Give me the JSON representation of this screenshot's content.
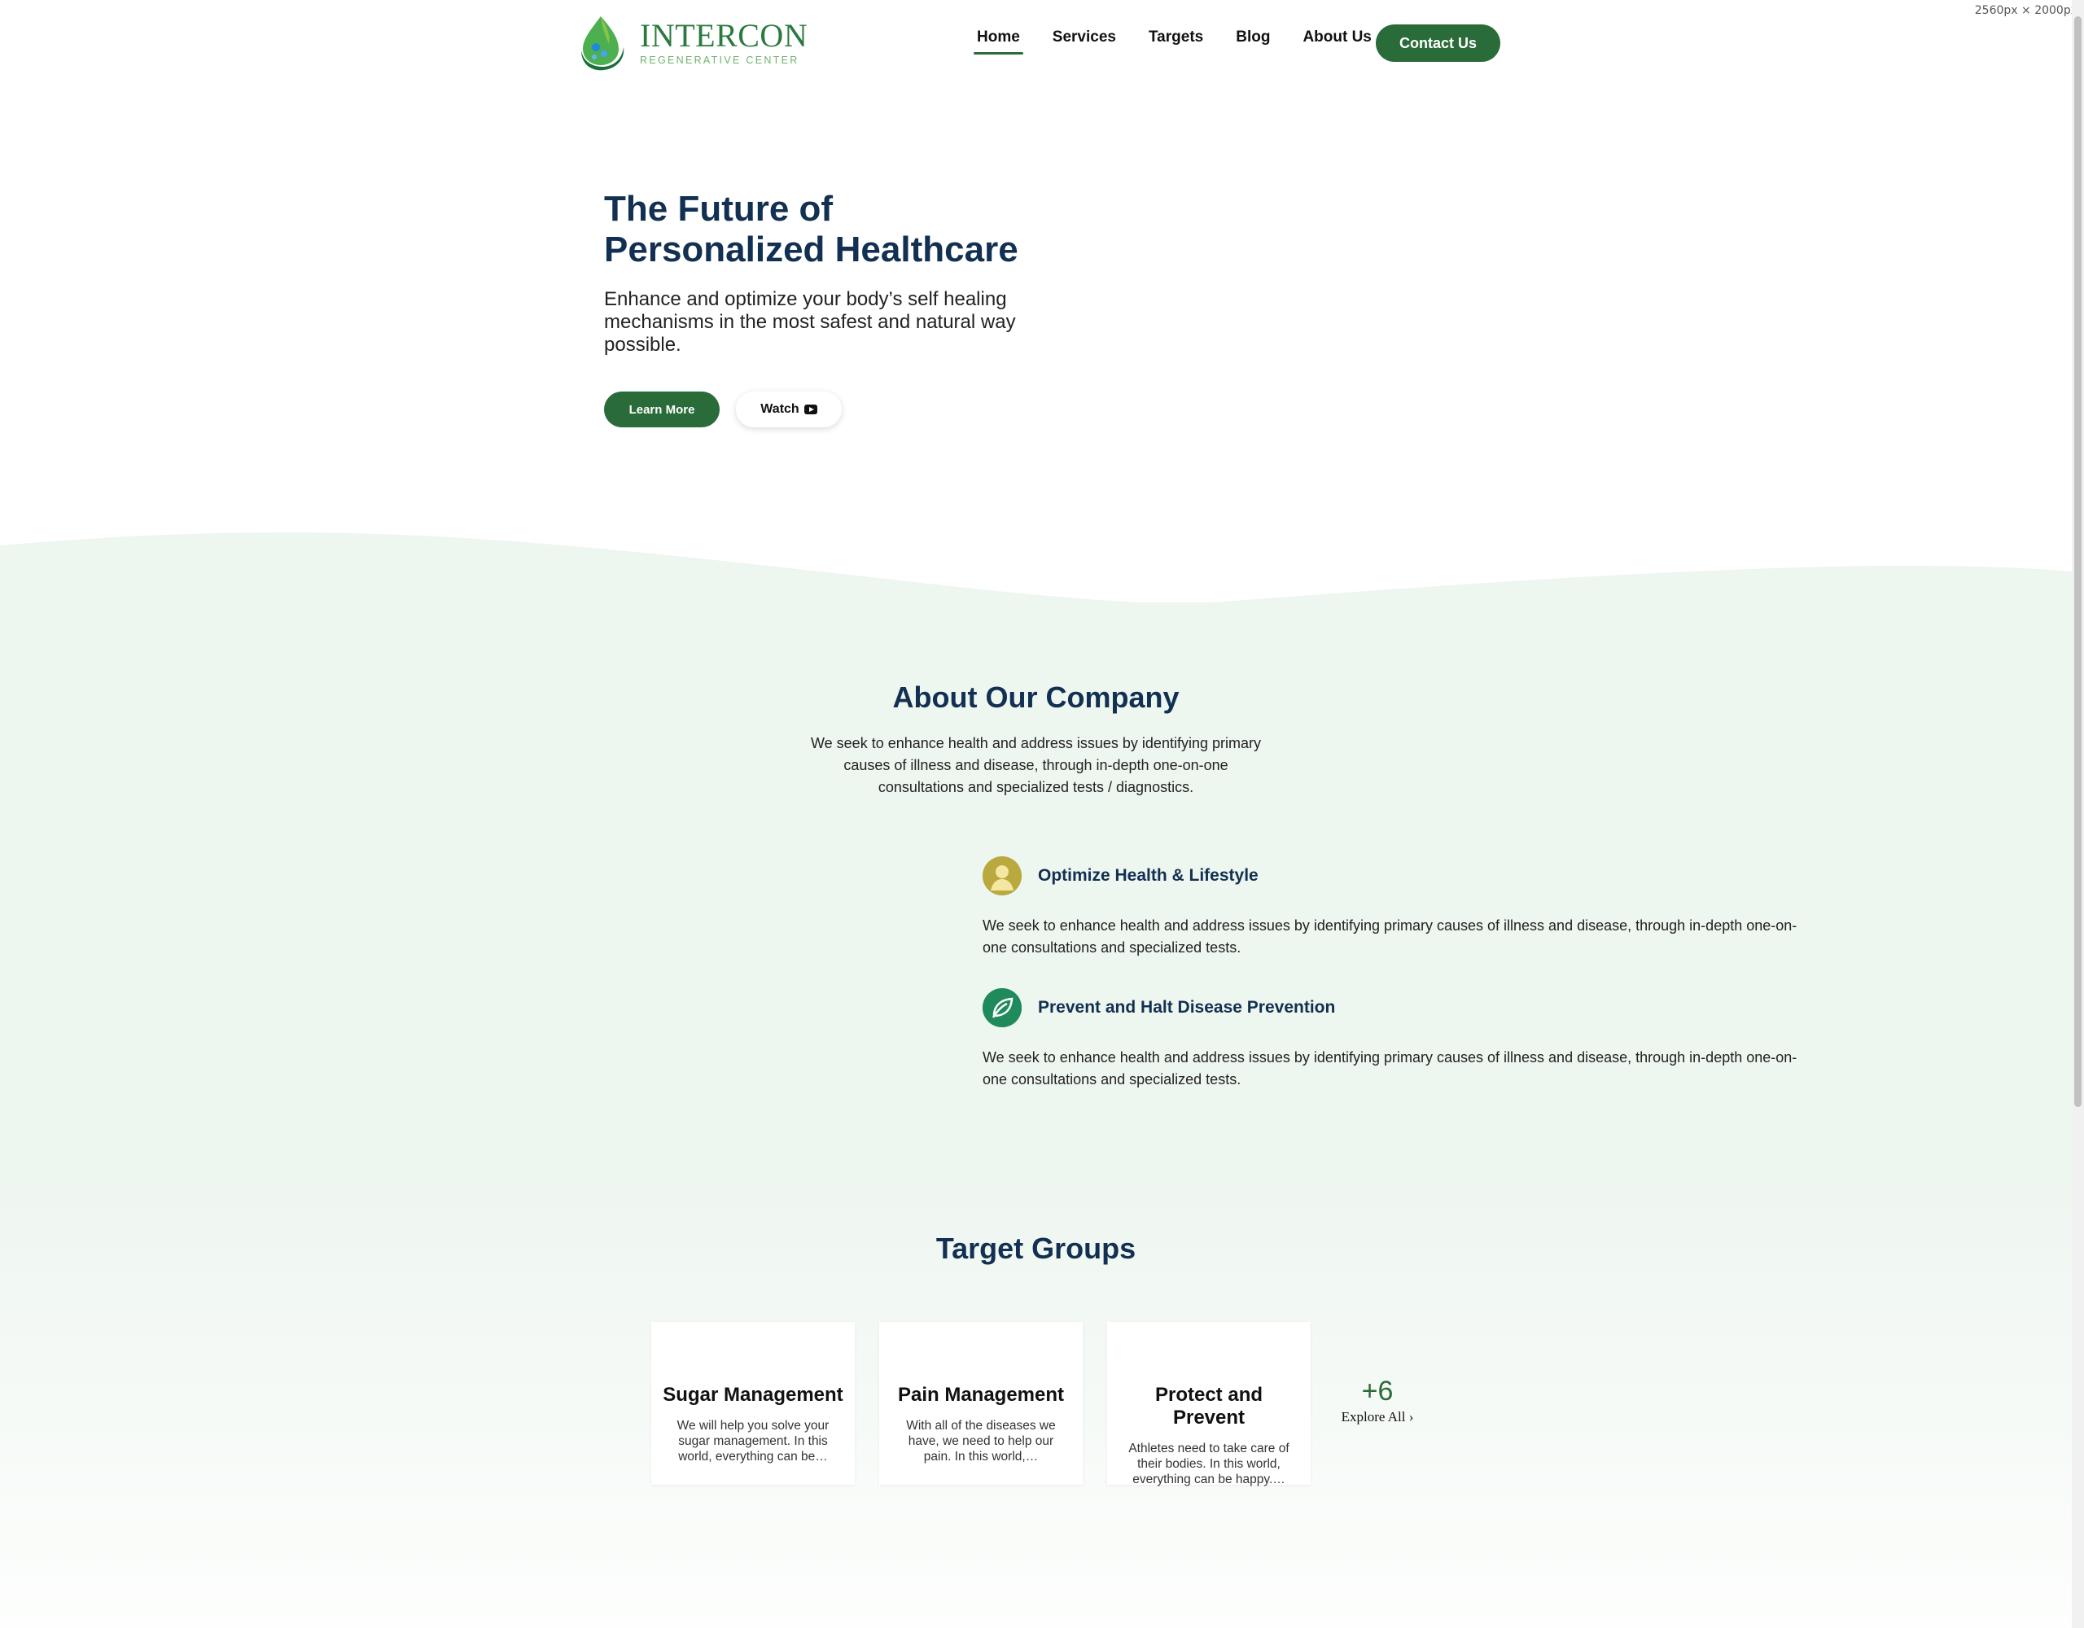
{
  "screen_label": "2560px × 2000px",
  "logo": {
    "name": "INTERCON",
    "sub": "REGENERATIVE CENTER"
  },
  "nav": {
    "items": [
      {
        "label": "Home",
        "active": true
      },
      {
        "label": "Services"
      },
      {
        "label": "Targets"
      },
      {
        "label": "Blog"
      },
      {
        "label": "About Us"
      }
    ],
    "contact_label": "Contact Us"
  },
  "hero": {
    "title": "The Future of Personalized Healthcare",
    "subtitle": "Enhance and optimize your body’s self healing mechanisms in the most safest and natural way possible.",
    "learn_more": "Learn More",
    "watch": "Watch"
  },
  "about": {
    "title": "About Our Company",
    "description": "We seek to enhance health and address issues by identifying primary causes of illness and disease, through in-depth one-on-one consultations and specialized tests / diagnostics.",
    "features": [
      {
        "icon": "person-icon",
        "title": "Optimize Health & Lifestyle",
        "text": "We seek to enhance health and address issues by identifying primary causes of illness and disease, through in-depth one-on-one consultations and specialized tests."
      },
      {
        "icon": "leaf-icon",
        "title": "Prevent and Halt Disease Prevention",
        "text": "We seek to enhance health and address issues by identifying primary causes of illness and disease, through in-depth one-on-one consultations and specialized tests."
      }
    ]
  },
  "targets": {
    "title": "Target Groups",
    "cards": [
      {
        "title": "Sugar Management",
        "text": "We will help you solve your sugar management. In this world, everything can be…"
      },
      {
        "title": "Pain Management",
        "text": "With all of the diseases we have, we need to help our pain. In this world,…"
      },
      {
        "title": "Protect and Prevent",
        "text": "Athletes need to take care of their bodies. In this world, everything can be happy.…"
      }
    ],
    "more_count": "+6",
    "explore_label": "Explore All ›"
  },
  "colors": {
    "brand_green": "#2a6b3a",
    "heading_navy": "#123052",
    "section_bg": "#eef6f0"
  }
}
